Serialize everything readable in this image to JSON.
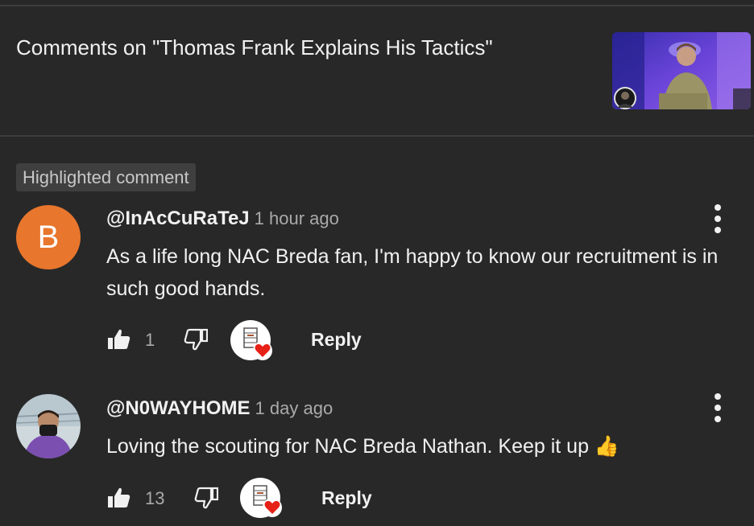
{
  "header": {
    "title": "Comments on \"Thomas Frank Explains His Tactics\""
  },
  "highlight": {
    "label": "Highlighted comment"
  },
  "comments": [
    {
      "avatar_letter": "B",
      "avatar_color": "#e8762c",
      "author": "@InAcCuRaTeJ",
      "time": "1 hour ago",
      "text": "As a life long NAC Breda fan, I'm happy to know our recruitment is in such good hands.",
      "likes": "1",
      "reply_label": "Reply",
      "creator_heart": true
    },
    {
      "avatar_letter": "",
      "author": "@N0WAYHOME",
      "time": "1 day ago",
      "text": "Loving the scouting for NAC Breda Nathan. Keep it up 👍",
      "likes": "13",
      "reply_label": "Reply",
      "creator_heart": true
    }
  ],
  "icons": {
    "like": "thumbs-up-icon",
    "dislike": "thumbs-down-icon",
    "more": "more-vertical-icon",
    "heart": "heart-icon"
  },
  "colors": {
    "background": "#282828",
    "heart": "#e62117",
    "badge_bg": "#3f3f3f"
  }
}
